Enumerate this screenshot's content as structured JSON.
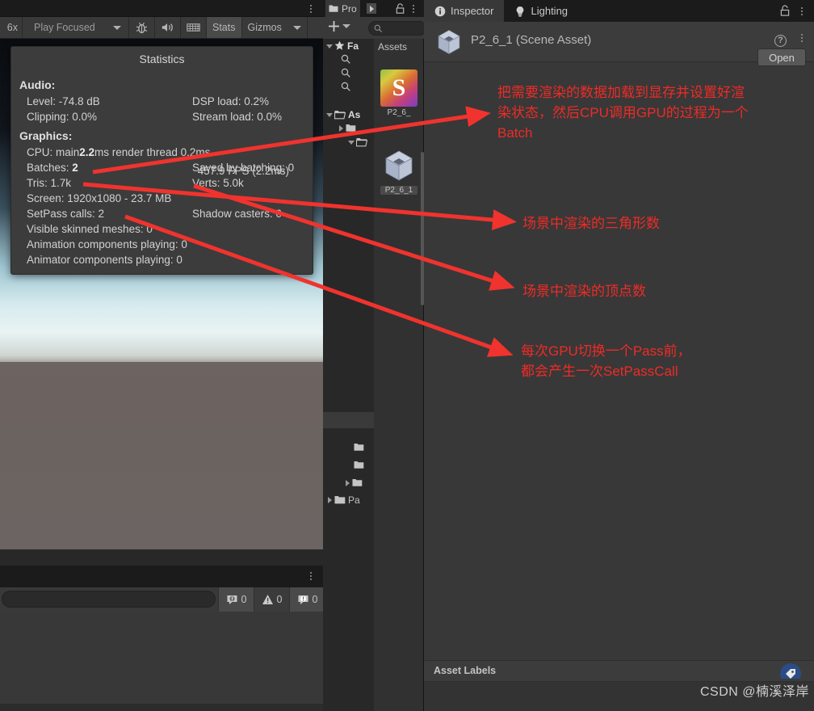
{
  "game_panel": {
    "scale_label": "6x",
    "aspect_label": "Play Focused",
    "stats_label": "Stats",
    "gizmos_label": "Gizmos",
    "mute_icon": "speaker-icon",
    "debug_icon": "bug-icon",
    "grid_icon": "grid-icon"
  },
  "statistics": {
    "title": "Statistics",
    "audio_heading": "Audio:",
    "audio_rows": [
      {
        "left": "Level: -74.8 dB",
        "right": "DSP load: 0.2%"
      },
      {
        "left": "Clipping: 0.0%",
        "right": "Stream load: 0.0%"
      }
    ],
    "graphics_heading": "Graphics:",
    "fps": "457.9 FPS (2.2ms)",
    "cpu_prefix": "CPU: main ",
    "cpu_main": "2.2",
    "cpu_suffix": "ms  render thread 0.2ms",
    "batches_label": "Batches: ",
    "batches_value": "2",
    "saved_by_batching": "Saved by batching: 0",
    "tris": "Tris: 1.7k",
    "verts": "Verts: 5.0k",
    "screen": "Screen: 1920x1080 - 23.7 MB",
    "setpass": "SetPass calls: 2",
    "shadow_casters": "Shadow casters: 0",
    "visible_skinned": "Visible skinned meshes: 0",
    "animation_components": "Animation components playing: 0",
    "animator_components": "Animator components playing: 0"
  },
  "console": {
    "search_placeholder": "",
    "log_count": "0",
    "warning_count": "0",
    "error_count": "0"
  },
  "project": {
    "tab_label": "Pro",
    "add_label": "+",
    "search_placeholder": "",
    "assets_header": "Assets",
    "tree": [
      {
        "label": "Fa",
        "indent": 0,
        "twisty": "open",
        "icon": "star-icon",
        "bold": true
      },
      {
        "label": "",
        "indent": 1,
        "twisty": "none",
        "icon": "search-icon",
        "bold": false
      },
      {
        "label": "",
        "indent": 1,
        "twisty": "none",
        "icon": "search-icon",
        "bold": false
      },
      {
        "label": "",
        "indent": 1,
        "twisty": "none",
        "icon": "search-icon",
        "bold": false
      },
      {
        "label": "",
        "indent": 0,
        "twisty": "none",
        "icon": "none",
        "bold": false
      },
      {
        "label": "As",
        "indent": 0,
        "twisty": "open",
        "icon": "folder-open-icon",
        "bold": true
      },
      {
        "label": "",
        "indent": 1,
        "twisty": "closed",
        "icon": "folder-icon",
        "bold": false
      },
      {
        "label": "",
        "indent": 1,
        "twisty": "open",
        "icon": "folder-open-icon",
        "bold": false
      },
      {
        "label": "",
        "indent": 2,
        "twisty": "none",
        "icon": "folder-icon",
        "bold": false
      },
      {
        "label": "",
        "indent": 2,
        "twisty": "none",
        "icon": "folder-icon",
        "bold": false
      },
      {
        "label": "",
        "indent": 2,
        "twisty": "closed",
        "icon": "folder-icon",
        "bold": false
      },
      {
        "label": "Pa",
        "indent": 0,
        "twisty": "closed",
        "icon": "folder-icon",
        "bold": false
      }
    ],
    "assets": [
      {
        "name": "P2_6_",
        "icon": "shader-icon",
        "letter": "S",
        "selected": false
      },
      {
        "name": "P2_6_1",
        "icon": "unity-scene-icon",
        "letter": "",
        "selected": true
      }
    ]
  },
  "inspector": {
    "tabs": [
      {
        "label": "Inspector",
        "icon": "info-icon",
        "active": true
      },
      {
        "label": "Lighting",
        "icon": "bulb-icon",
        "active": false
      }
    ],
    "asset_title": "P2_6_1 (Scene Asset)",
    "asset_icon": "unity-scene-icon",
    "help_icon": "?",
    "open_button": "Open",
    "asset_labels": "Asset Labels",
    "label_tag_icon": "tag-icon"
  },
  "annotations": {
    "accent_color": "#ee2b26",
    "items": [
      {
        "id": 1,
        "text": "把需要渲染的数据加载到显存并设置好渲\n染状态，然后CPU调用GPU的过程为一个\nBatch"
      },
      {
        "id": 2,
        "text": "场景中渲染的三角形数"
      },
      {
        "id": 3,
        "text": "场景中渲染的顶点数"
      },
      {
        "id": 4,
        "text": "每次GPU切换一个Pass前，\n都会产生一次SetPassCall"
      }
    ]
  },
  "watermark": "CSDN @楠溪泽岸"
}
